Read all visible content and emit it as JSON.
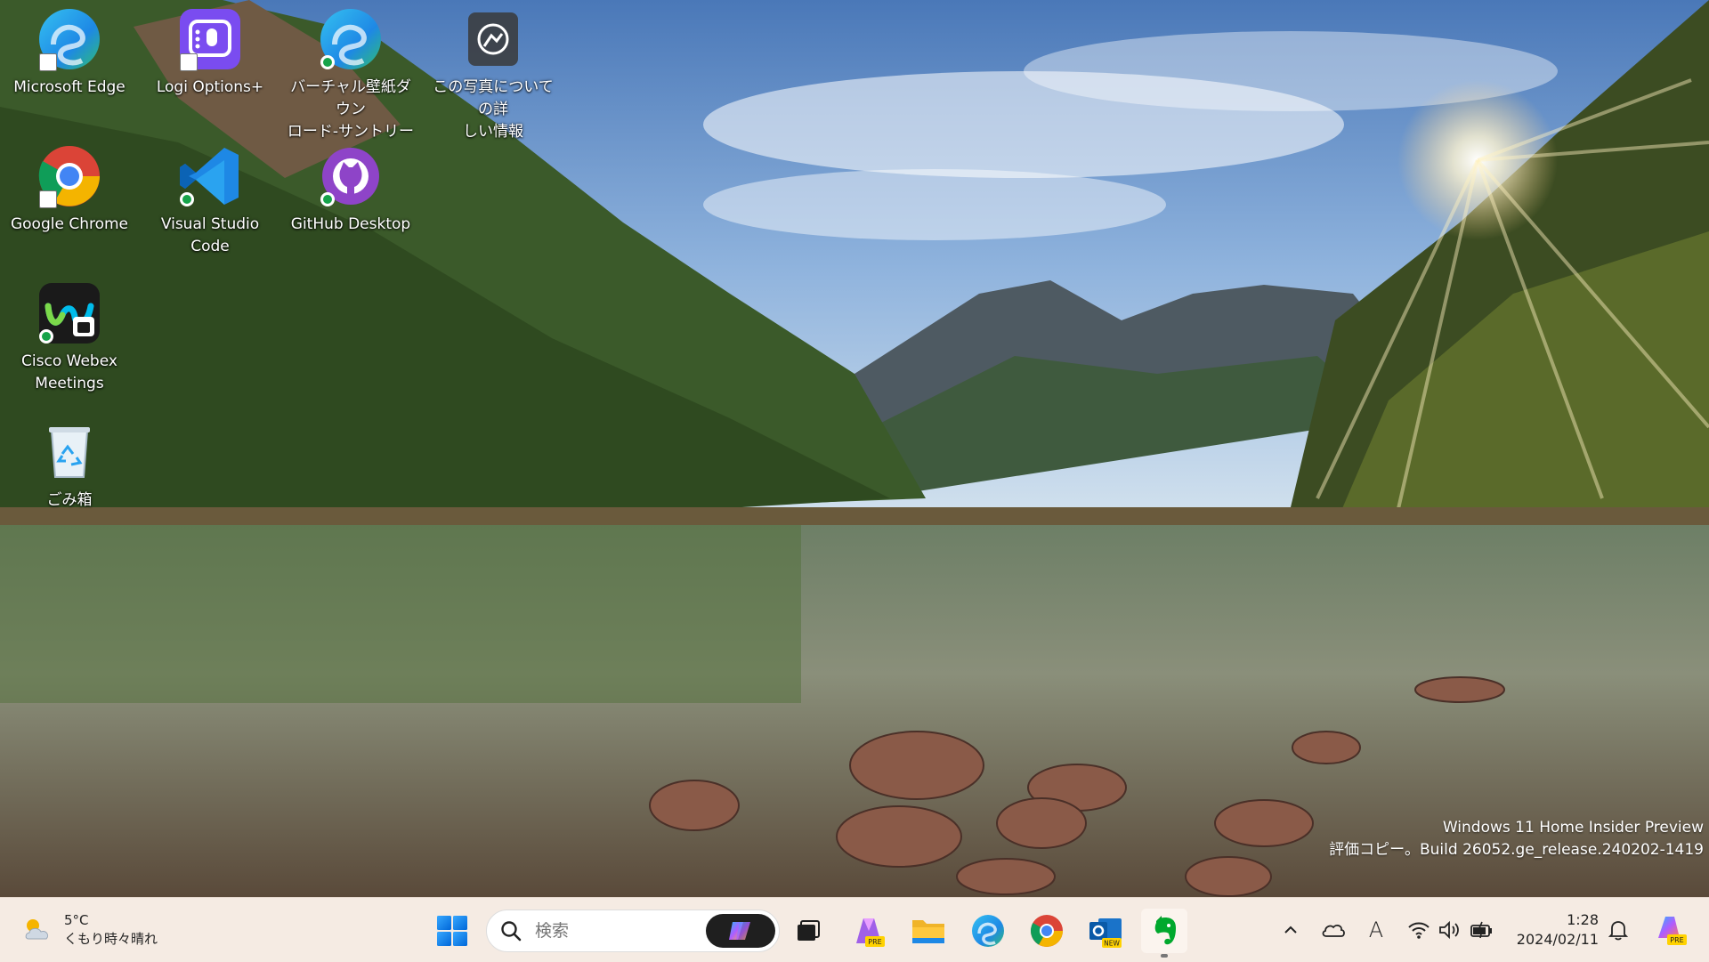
{
  "desktop": {
    "icons": [
      {
        "label": "Microsoft Edge",
        "icon": "edge-icon"
      },
      {
        "label": "Logi Options+",
        "icon": "logi-options-icon"
      },
      {
        "label": "バーチャル壁紙ダウンロード-サントリー",
        "label_line1": "バーチャル壁紙ダウン",
        "label_line2": "ロード-サントリー",
        "icon": "edge-icon"
      },
      {
        "label": "この写真についての詳しい情報",
        "label_line1": "この写真についての詳",
        "label_line2": "しい情報",
        "icon": "camera-info-icon"
      },
      {
        "label": "Google Chrome",
        "icon": "chrome-icon"
      },
      {
        "label": "Visual Studio Code",
        "icon": "vscode-icon"
      },
      {
        "label": "GitHub Desktop",
        "icon": "github-desktop-icon"
      },
      {
        "label": "Cisco Webex Meetings",
        "label_line1": "Cisco Webex",
        "label_line2": "Meetings",
        "icon": "webex-icon"
      },
      {
        "label": "ごみ箱",
        "icon": "recycle-bin-icon"
      }
    ]
  },
  "watermark": {
    "line1": "Windows 11 Home Insider Preview",
    "line2": "評価コピー。Build 26052.ge_release.240202-1419"
  },
  "taskbar": {
    "weather": {
      "temp": "5°C",
      "condition": "くもり時々晴れ",
      "icon": "partly-cloudy-icon"
    },
    "search_placeholder": "検索",
    "apps": [
      "windows-start-icon",
      "task-view-icon",
      "copilot-pre-icon",
      "file-explorer-icon",
      "edge-icon",
      "chrome-icon",
      "outlook-new-icon",
      "evernote-icon"
    ],
    "tray": [
      "chevron-up-icon",
      "onedrive-icon",
      "ime-icon",
      "wifi-icon",
      "volume-icon",
      "battery-icon"
    ],
    "ime_label": "A",
    "clock": {
      "time": "1:28",
      "date": "2024/02/11"
    }
  },
  "colors": {
    "taskbar_bg": "#f5ebe3",
    "accent_blue": "#0078d4",
    "evernote_green": "#00a82d"
  }
}
